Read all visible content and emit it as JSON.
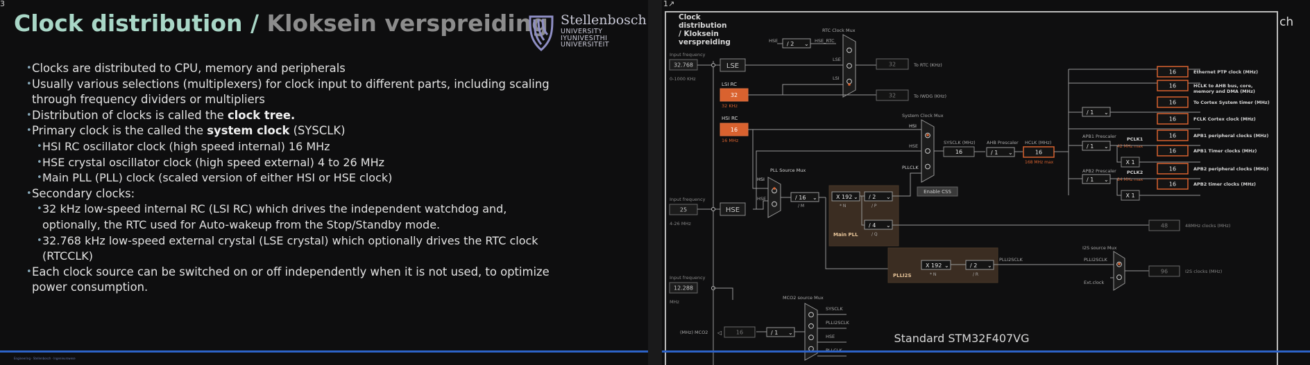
{
  "left_slide": {
    "corner_number": "3",
    "title_en": "Clock distribution",
    "title_sep": " / ",
    "title_af": "Kloksein verspreiding",
    "logo": {
      "name": "Stellenbosch",
      "line2": "UNIVERSITY",
      "line3": "IYUNIVESITHI",
      "line4": "UNIVERSITEIT"
    },
    "bullets": [
      {
        "level": 1,
        "parts": [
          {
            "t": "Clocks are distributed to CPU, memory and peripherals"
          }
        ]
      },
      {
        "level": 1,
        "parts": [
          {
            "t": "Usually various selections (multiplexers) for clock input to different parts, including scaling"
          }
        ]
      },
      {
        "level": 0,
        "parts": [
          {
            "t": "through frequency dividers or multipliers"
          }
        ]
      },
      {
        "level": 1,
        "parts": [
          {
            "t": "Distribution of clocks is called the "
          },
          {
            "t": "clock tree.",
            "bold": true
          }
        ]
      },
      {
        "level": 1,
        "parts": [
          {
            "t": "Primary clock is the called the "
          },
          {
            "t": "system clock",
            "bold": true
          },
          {
            "t": " (SYSCLK)"
          }
        ]
      },
      {
        "level": 2,
        "parts": [
          {
            "t": "HSI RC oscillator clock (high speed internal) 16 MHz"
          }
        ]
      },
      {
        "level": 2,
        "parts": [
          {
            "t": "HSE crystal oscillator clock (high speed external) 4 to 26 MHz"
          }
        ]
      },
      {
        "level": 2,
        "parts": [
          {
            "t": "Main PLL (PLL) clock (scaled version of either HSI or HSE clock)"
          }
        ]
      },
      {
        "level": 1,
        "parts": [
          {
            "t": "Secondary clocks:"
          }
        ]
      },
      {
        "level": 2,
        "parts": [
          {
            "t": "32 kHz low-speed internal RC (LSI RC) which drives the independent watchdog and,"
          }
        ]
      },
      {
        "level": 3,
        "parts": [
          {
            "t": "optionally, the RTC used for Auto-wakeup from the Stop/Standby mode."
          }
        ]
      },
      {
        "level": 2,
        "parts": [
          {
            "t": "32.768 kHz low-speed external crystal (LSE crystal) which optionally drives the RTC clock"
          }
        ]
      },
      {
        "level": 3,
        "parts": [
          {
            "t": "(RTCCLK)"
          }
        ]
      },
      {
        "level": 1,
        "parts": [
          {
            "t": "Each clock source can be switched on or off independently when it is not used, to optimize"
          }
        ]
      },
      {
        "level": 0,
        "parts": [
          {
            "t": "power consumption."
          }
        ]
      }
    ],
    "footer": "Engineering · Stellenbosch · Ingenieurswese"
  },
  "right_slide": {
    "corner_icon": "1↗",
    "edge_text": "ch",
    "header": [
      "Clock",
      "distribution",
      "/ Kloksein",
      "verspreiding"
    ],
    "caption": "Standard STM32F407VG",
    "diagram": {
      "input_frequency_label": "Input frequency",
      "lse_input": "32.768",
      "lse_range": "0-1000 KHz",
      "lse_label": "LSE",
      "lsi_label": "LSI RC",
      "lsi_value": "32",
      "lsi_unit": "32 KHz",
      "hsi_label": "HSI RC",
      "hsi_value": "16",
      "hsi_unit": "16 MHz",
      "hse_input": "25",
      "hse_range": "4-26 MHz",
      "hse_label": "HSE",
      "i2s_input": "12.288",
      "i2s_unit": "MHz",
      "rtc_mux": "RTC Clock Mux",
      "hse_div": "/ 2",
      "hse_rtc": "HSE_RTC",
      "rtc_val": "32",
      "to_rtc": "To RTC (KHz)",
      "iwdg_val": "32",
      "to_iwdg": "To IWDG (KHz)",
      "sys_mux": "System Clock Mux",
      "sysclk_label": "SYSCLK (MHz)",
      "sysclk_val": "16",
      "ahb_label": "AHB Prescaler",
      "ahb_val": "/ 1",
      "hclk_label": "HCLK (MHz)",
      "hclk_val": "16",
      "hclk_max": "168 MHz max",
      "enable_css": "Enable CSS",
      "pll_src_mux": "PLL Source Mux",
      "pllm": "/ 16",
      "m_label": "/ M",
      "plln": "X 192",
      "n_label": "* N",
      "pllp": "/ 2",
      "p_label": "/ P",
      "pllq": "/ 4",
      "q_label": "/ Q",
      "main_pll": "Main PLL",
      "pllclk": "PLLCLK",
      "cortex_div": "/ 1",
      "apb1_label": "APB1 Prescaler",
      "apb1_val": "/ 1",
      "pclk1": "PCLK1",
      "pclk1_max": "42 MHz max",
      "apb2_label": "APB2 Prescaler",
      "apb2_val": "/ 1",
      "pclk2": "PCLK2",
      "pclk2_max": "84 MHz max",
      "x1a": "X 1",
      "x1b": "X 1",
      "outputs": [
        {
          "val": "16",
          "label": "Ethernet PTP clock (MHz)"
        },
        {
          "val": "16",
          "label": "HCLK to AHB bus, core,"
        },
        {
          "val": "16",
          "label": "To Cortex System timer (MHz)"
        },
        {
          "val": "16",
          "label": "FCLK Cortex clock (MHz)"
        },
        {
          "val": "16",
          "label": "APB1 peripheral clocks (MHz)"
        },
        {
          "val": "16",
          "label": "APB1 Timer clocks (MHz)"
        },
        {
          "val": "16",
          "label": "APB2 peripheral clocks (MHz)"
        },
        {
          "val": "16",
          "label": "APB2 timer clocks (MHz)"
        }
      ],
      "hclk_line2": "memory and DMA (MHz)",
      "usb_val": "48",
      "usb_label": "48MHz clocks (MHz)",
      "plli2s_n": "X 192",
      "plli2s_r": "/ 2",
      "r_label": "/ R",
      "plli2s_label": "PLLI2S",
      "plli2sclk": "PLLI2SCLK",
      "i2s_mux": "I2S source Mux",
      "ext_clock": "Ext.clock",
      "i2s_val": "96",
      "i2s_label": "I2S clocks (MHz)",
      "mco2_mux": "MCO2 source Mux",
      "mco2_out": "(MHz) MCO2",
      "mco2_val": "16",
      "mco2_div": "/ 1",
      "mco2_inputs": [
        "SYSCLK",
        "PLLI2SCLK",
        "HSE",
        "PLLCLK"
      ],
      "lse_tag": "LSE",
      "lsi_tag": "LSI",
      "hsi_tag": "HSI",
      "hse_tag": "HSE",
      "accent": "#d9622f"
    }
  }
}
